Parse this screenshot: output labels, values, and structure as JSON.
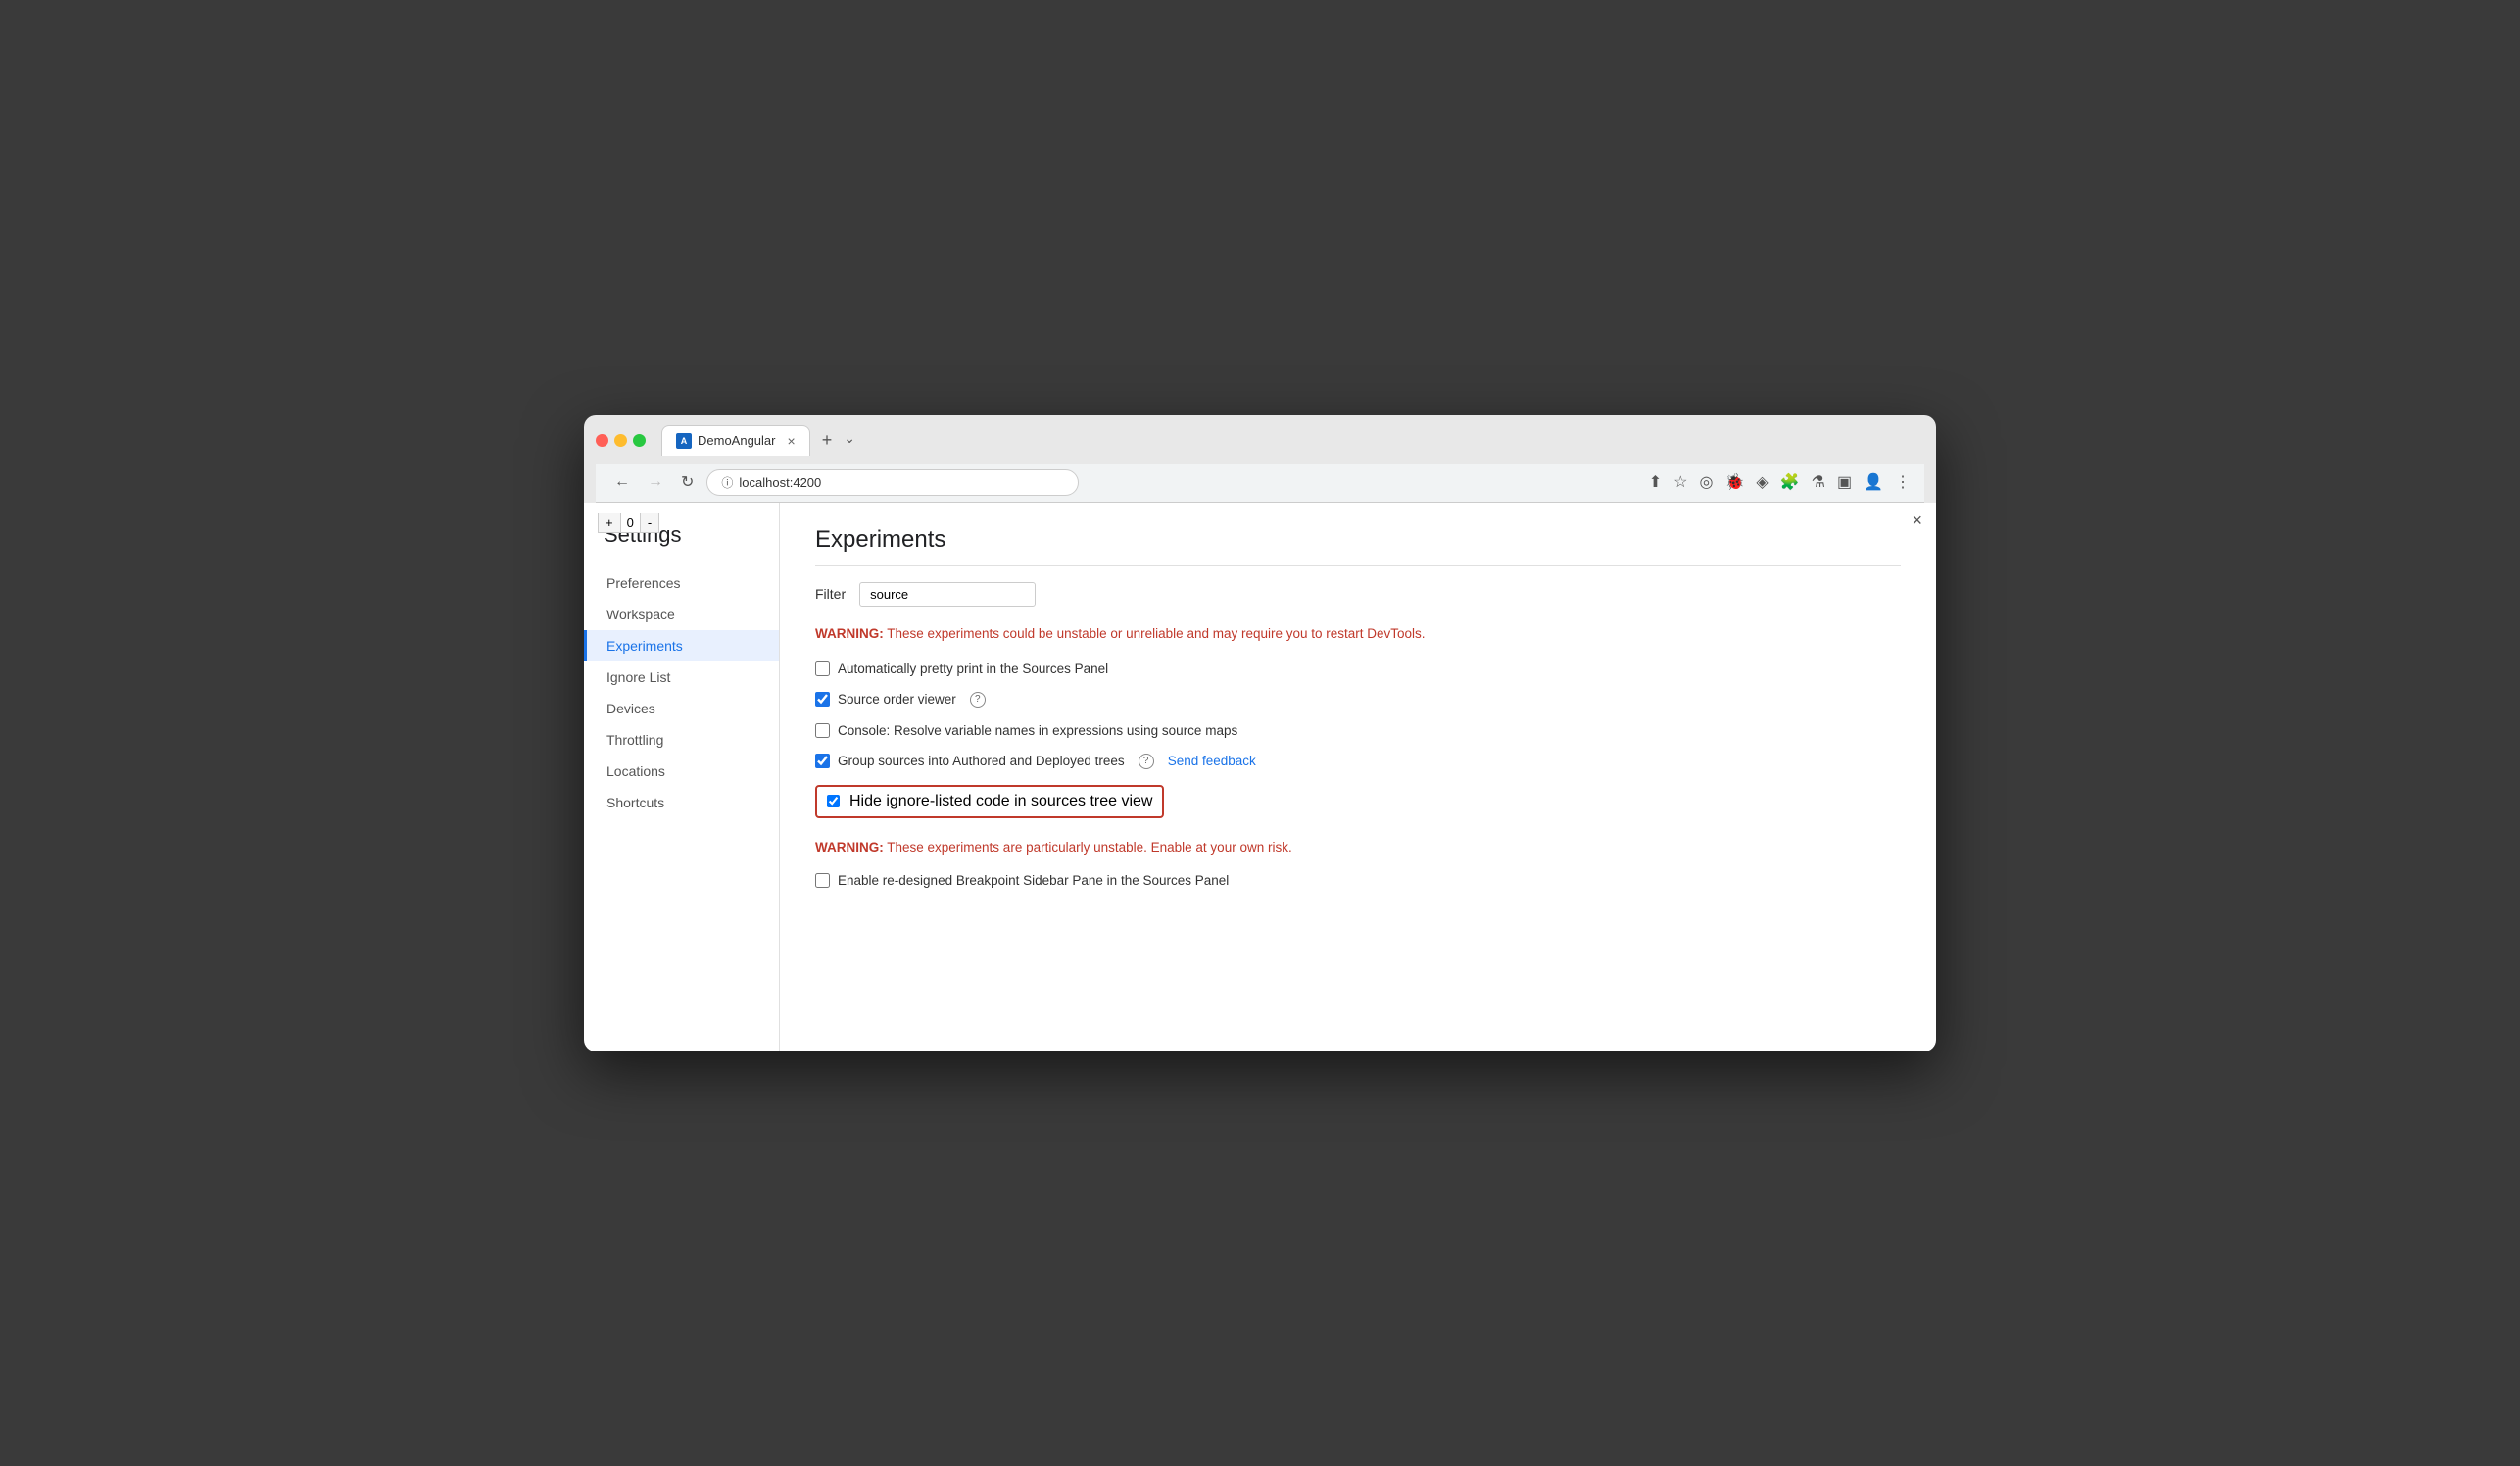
{
  "browser": {
    "tab_title": "DemoAngular",
    "tab_close": "×",
    "tab_new": "+",
    "tab_end_chevron": "⌄",
    "address": "localhost:4200",
    "nav_back": "←",
    "nav_forward": "→",
    "nav_reload": "↻",
    "window_controls": [
      "dot-red",
      "dot-yellow",
      "dot-green"
    ],
    "devtools_close": "×",
    "counter_minus": "-",
    "counter_val": "0",
    "counter_plus": "+"
  },
  "settings": {
    "title": "Settings",
    "nav_items": [
      {
        "id": "preferences",
        "label": "Preferences",
        "active": false
      },
      {
        "id": "workspace",
        "label": "Workspace",
        "active": false
      },
      {
        "id": "experiments",
        "label": "Experiments",
        "active": true
      },
      {
        "id": "ignore-list",
        "label": "Ignore List",
        "active": false
      },
      {
        "id": "devices",
        "label": "Devices",
        "active": false
      },
      {
        "id": "throttling",
        "label": "Throttling",
        "active": false
      },
      {
        "id": "locations",
        "label": "Locations",
        "active": false
      },
      {
        "id": "shortcuts",
        "label": "Shortcuts",
        "active": false
      }
    ]
  },
  "experiments": {
    "title": "Experiments",
    "filter_label": "Filter",
    "filter_value": "source",
    "filter_placeholder": "",
    "warning1_label": "WARNING:",
    "warning1_text": " These experiments could be unstable or unreliable and may require you to restart DevTools.",
    "items": [
      {
        "id": "auto-pretty-print",
        "label": "Automatically pretty print in the Sources Panel",
        "checked": false,
        "highlighted": false,
        "has_help": false,
        "has_feedback": false
      },
      {
        "id": "source-order-viewer",
        "label": "Source order viewer",
        "checked": true,
        "highlighted": false,
        "has_help": true,
        "has_feedback": false
      },
      {
        "id": "console-resolve",
        "label": "Console: Resolve variable names in expressions using source maps",
        "checked": false,
        "highlighted": false,
        "has_help": false,
        "has_feedback": false
      },
      {
        "id": "group-sources",
        "label": "Group sources into Authored and Deployed trees",
        "checked": true,
        "highlighted": false,
        "has_help": true,
        "has_feedback": true
      },
      {
        "id": "hide-ignore-listed",
        "label": "Hide ignore-listed code in sources tree view",
        "checked": true,
        "highlighted": true,
        "has_help": false,
        "has_feedback": false
      }
    ],
    "warning2_label": "WARNING:",
    "warning2_text": " These experiments are particularly unstable. Enable at your own risk.",
    "items2": [
      {
        "id": "enable-breakpoint-sidebar",
        "label": "Enable re-designed Breakpoint Sidebar Pane in the Sources Panel",
        "checked": false
      }
    ],
    "help_icon": "?",
    "send_feedback_label": "Send feedback"
  }
}
